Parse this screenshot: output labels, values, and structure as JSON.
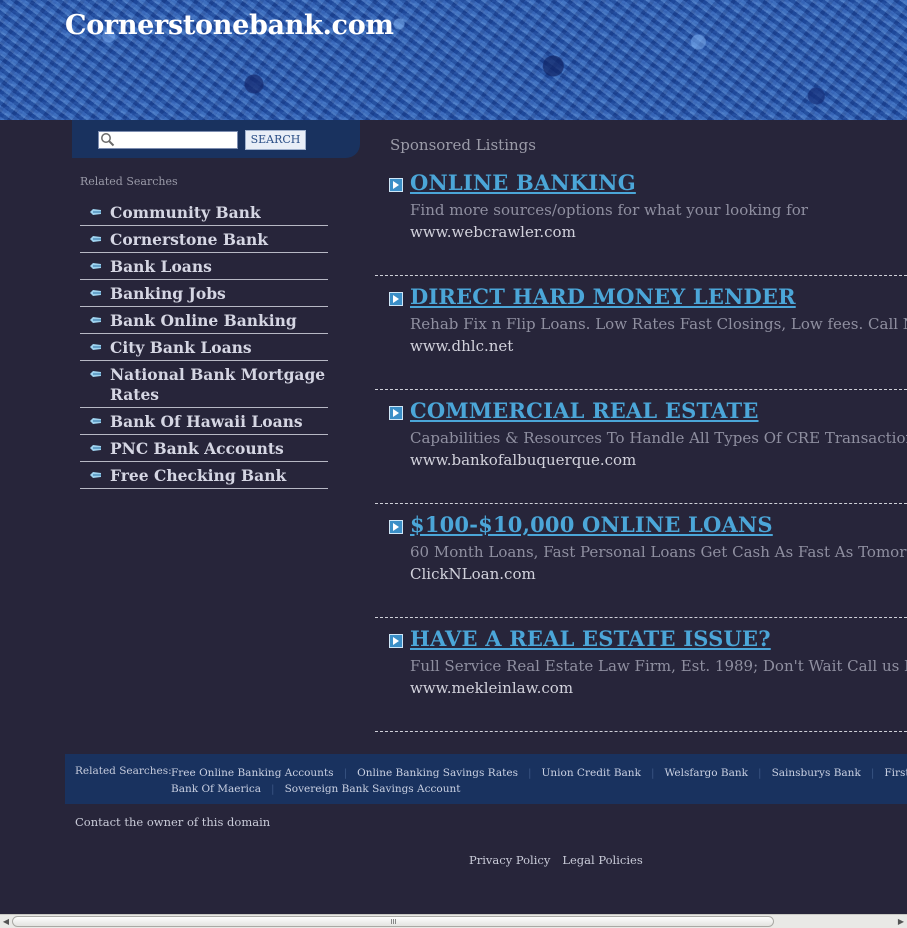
{
  "header": {
    "site_title": "Cornerstonebank.com"
  },
  "search": {
    "placeholder": "",
    "value": "",
    "button_label": "SEARCH"
  },
  "sidebar": {
    "heading": "Related Searches",
    "items": [
      {
        "label": "Community Bank"
      },
      {
        "label": "Cornerstone Bank"
      },
      {
        "label": "Bank Loans"
      },
      {
        "label": "Banking Jobs"
      },
      {
        "label": "Bank Online Banking"
      },
      {
        "label": "City Bank Loans"
      },
      {
        "label": "National Bank Mortgage Rates"
      },
      {
        "label": "Bank Of Hawaii Loans"
      },
      {
        "label": "PNC Bank Accounts"
      },
      {
        "label": "Free Checking Bank"
      }
    ]
  },
  "main": {
    "heading": "Sponsored Listings",
    "listings": [
      {
        "title": "ONLINE BANKING",
        "description": "Find more sources/options for what your looking for",
        "url": "www.webcrawler.com"
      },
      {
        "title": "DIRECT HARD MONEY LENDER",
        "description": "Rehab Fix n Flip Loans. Low Rates Fast Closings, Low fees. Call Now",
        "url": "www.dhlc.net"
      },
      {
        "title": "COMMERCIAL REAL ESTATE",
        "description": "Capabilities & Resources To Handle All Types Of CRE Transactions",
        "url": "www.bankofalbuquerque.com"
      },
      {
        "title": "$100-$10,000 ONLINE LOANS",
        "description": "60 Month Loans, Fast Personal Loans Get Cash As Fast As Tomorrow.",
        "url": "ClickNLoan.com"
      },
      {
        "title": "HAVE A REAL ESTATE ISSUE?",
        "description": "Full Service Real Estate Law Firm, Est. 1989; Don't Wait Call us Now!",
        "url": "www.mekleinlaw.com"
      }
    ]
  },
  "footer": {
    "related_label": "Related Searches:",
    "links": [
      "Free Online Banking Accounts",
      "Online Banking Savings Rates",
      "Union Credit Bank",
      "Welsfargo Bank",
      "Sainsburys Bank",
      "First Direct Bank",
      "Bank Of Maerica",
      "Sovereign Bank Savings Account"
    ],
    "contact": "Contact the owner of this domain",
    "privacy": "Privacy Policy",
    "legal": "Legal Policies"
  },
  "icons": {
    "search": "magnifier-icon",
    "sidebar_bullet": "pencil-bullet-icon",
    "listing_arrow": "arrow-right-icon"
  },
  "colors": {
    "page_background": "#27253a",
    "header_blue": "#1e4f9e",
    "panel_blue": "#19325f",
    "link_blue": "#4ba6d8"
  }
}
